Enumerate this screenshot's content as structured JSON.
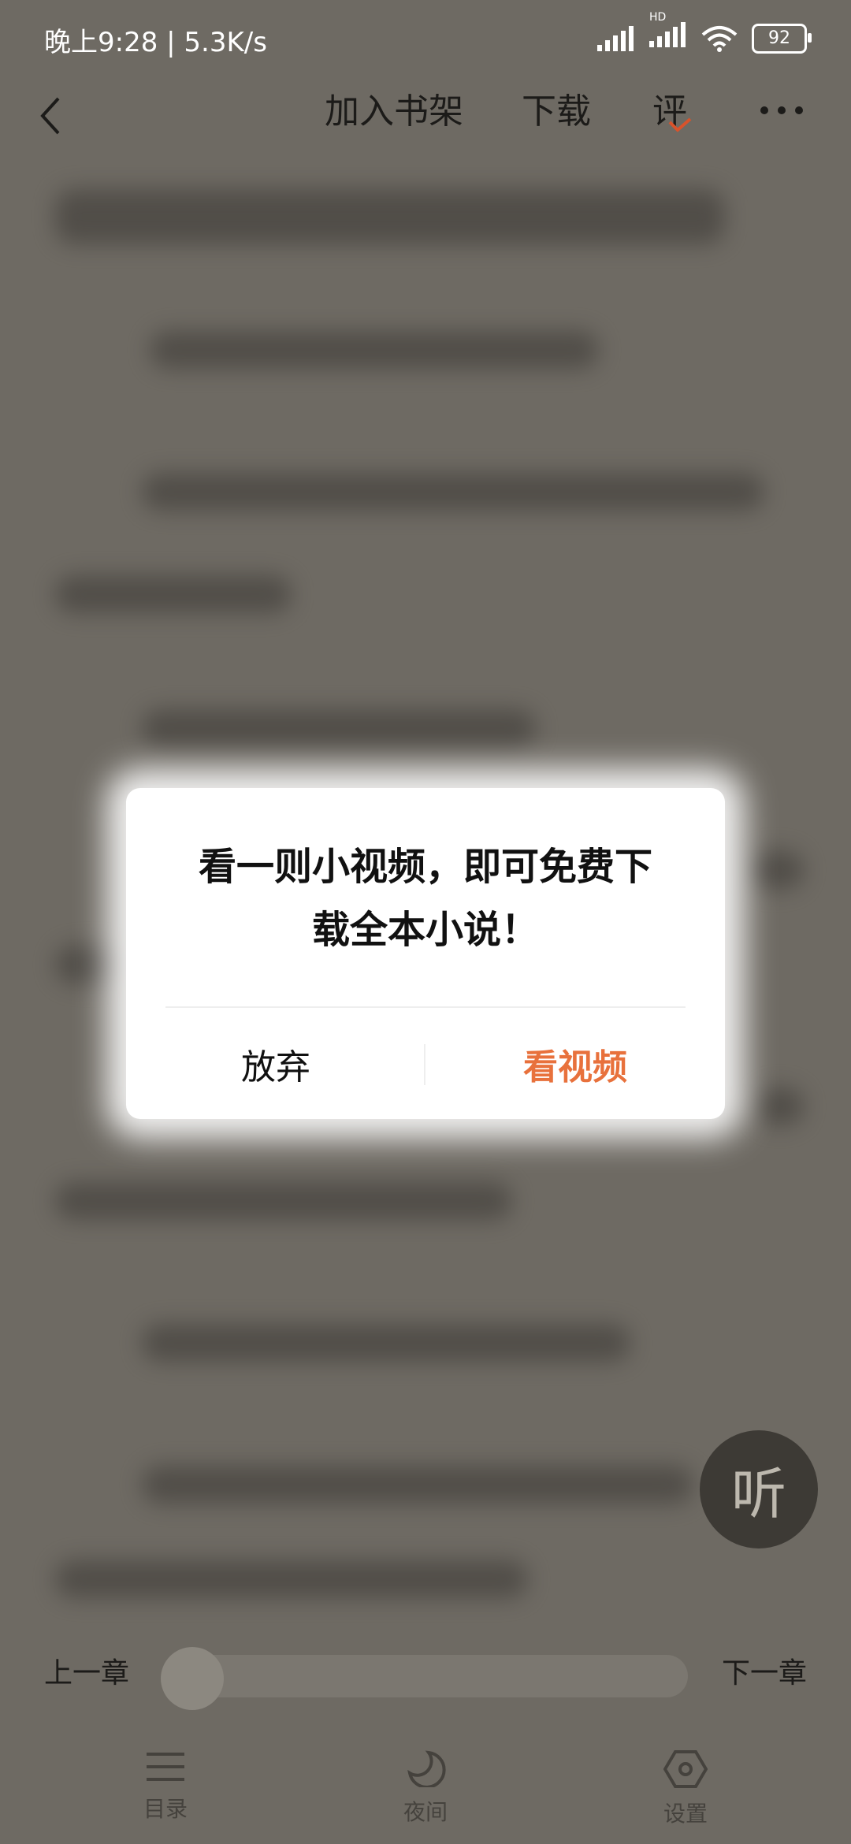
{
  "status_bar": {
    "time_speed": "晚上9:28 | 5.3K/s",
    "battery": "92",
    "network": "HD"
  },
  "top_nav": {
    "add_to_shelf": "加入书架",
    "download": "下载",
    "comment": "评"
  },
  "dialog": {
    "message_line1": "看一则小视频，即可免费下",
    "message_line2": "载全本小说！",
    "cancel_label": "放弃",
    "confirm_label": "看视频",
    "accent_color": "#e8713c"
  },
  "listen": {
    "label": "听"
  },
  "chapter_bar": {
    "prev": "上一章",
    "next": "下一章",
    "progress": 0
  },
  "bottom_bar": {
    "toc": "目录",
    "night": "夜间",
    "settings": "设置"
  }
}
